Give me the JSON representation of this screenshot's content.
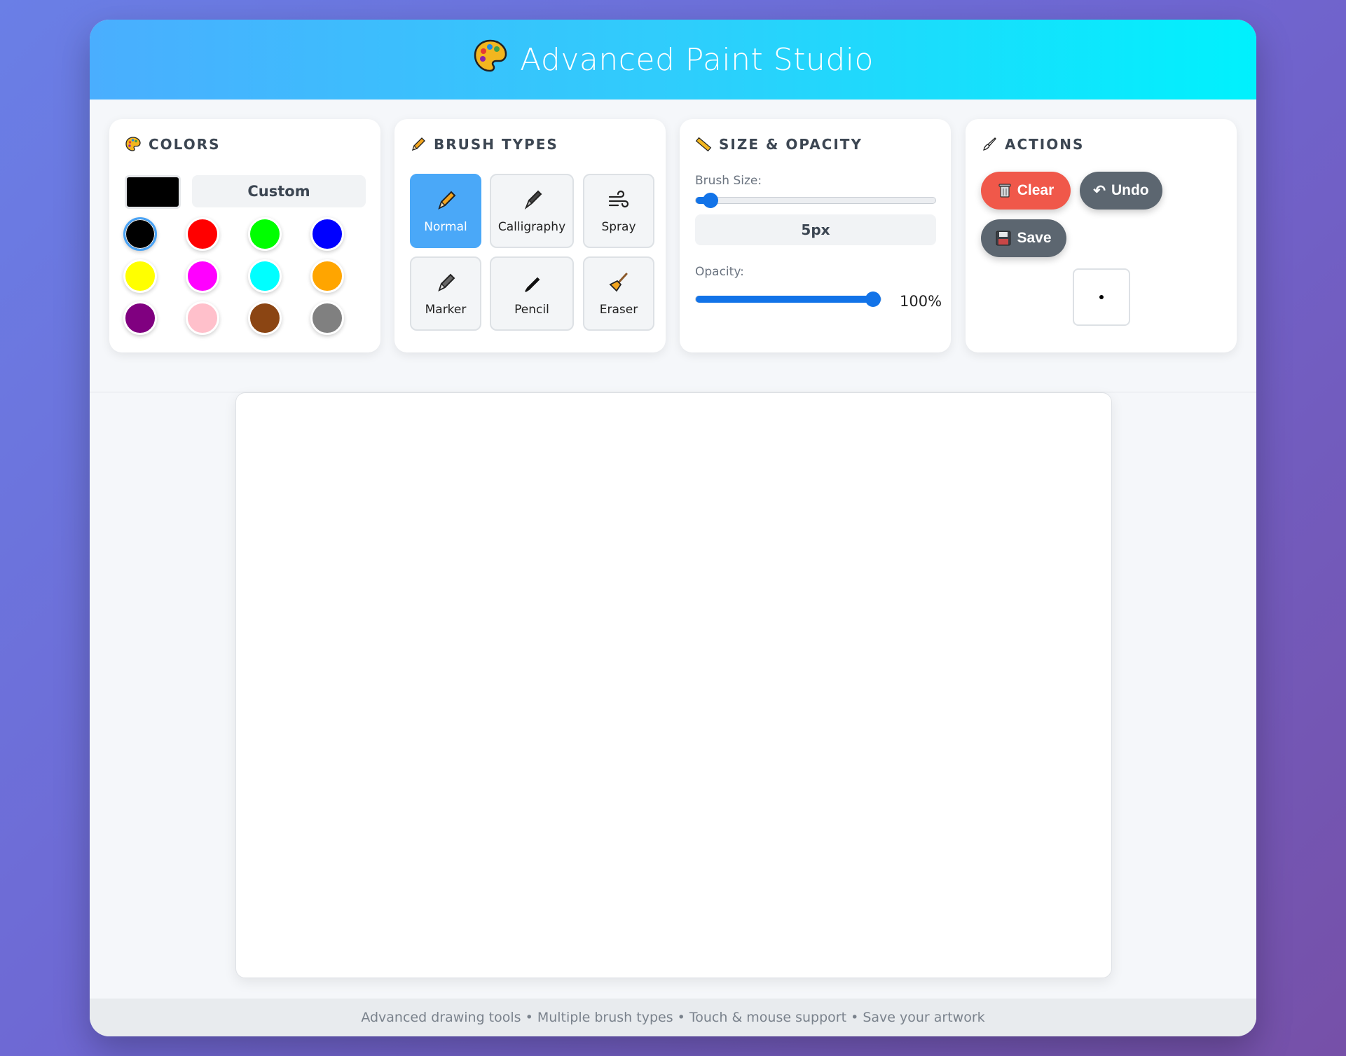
{
  "header": {
    "title": "Advanced Paint Studio",
    "icon": "palette-icon"
  },
  "colors_panel": {
    "title": "COLORS",
    "current_color": "#000000",
    "custom_label": "Custom",
    "swatches": [
      "#000000",
      "#ff0000",
      "#00ff00",
      "#0000ff",
      "#ffff00",
      "#ff00ff",
      "#00ffff",
      "#ffa500",
      "#800080",
      "#ffc0cb",
      "#8b4513",
      "#808080"
    ],
    "selected_index": 0
  },
  "brush_panel": {
    "title": "BRUSH TYPES",
    "brushes": [
      {
        "label": "Normal",
        "icon": "pencil-icon",
        "active": true
      },
      {
        "label": "Calligraphy",
        "icon": "fountain-pen-icon",
        "active": false
      },
      {
        "label": "Spray",
        "icon": "wind-icon",
        "active": false
      },
      {
        "label": "Marker",
        "icon": "marker-icon",
        "active": false
      },
      {
        "label": "Pencil",
        "icon": "pen-icon",
        "active": false
      },
      {
        "label": "Eraser",
        "icon": "broom-icon",
        "active": false
      }
    ]
  },
  "size_panel": {
    "title": "SIZE & OPACITY",
    "brush_size_label": "Brush Size:",
    "brush_size_value": "5px",
    "brush_size_fraction": 0.06,
    "opacity_label": "Opacity:",
    "opacity_value": "100%",
    "opacity_fraction": 1.0
  },
  "actions_panel": {
    "title": "ACTIONS",
    "clear_label": "Clear",
    "undo_label": "Undo",
    "save_label": "Save",
    "clear_color": "#f0584a",
    "neutral_color": "#5c6670"
  },
  "footer": {
    "text": "Advanced drawing tools • Multiple brush types • Touch & mouse support • Save your artwork"
  }
}
